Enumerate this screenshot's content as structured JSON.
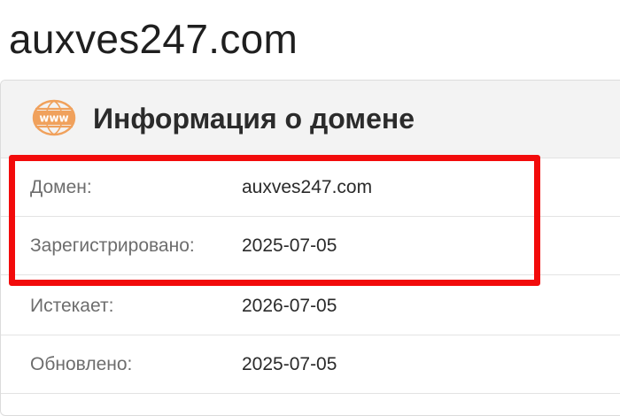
{
  "page": {
    "title": "auxves247.com"
  },
  "card": {
    "icon": "www-globe-icon",
    "icon_text": "www",
    "title": "Информация о домене",
    "rows": [
      {
        "label": "Домен:",
        "value": "auxves247.com"
      },
      {
        "label": "Зарегистрировано:",
        "value": "2025-07-05"
      },
      {
        "label": "Истекает:",
        "value": "2026-07-05"
      },
      {
        "label": "Обновлено:",
        "value": "2025-07-05"
      }
    ]
  },
  "colors": {
    "accent_icon": "#f0a15c",
    "highlight": "#f20b0b"
  }
}
